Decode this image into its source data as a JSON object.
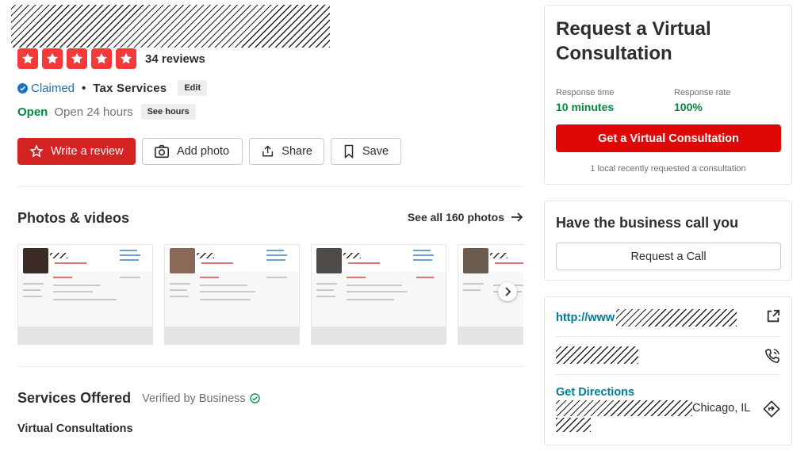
{
  "header": {
    "review_count": "34 reviews",
    "rating_stars": 5,
    "claimed_label": "Claimed",
    "separator": "•",
    "category": "Tax Services",
    "edit_label": "Edit",
    "status": "Open",
    "hours": "Open 24 hours",
    "see_hours_label": "See hours"
  },
  "actions": {
    "write_review": "Write a review",
    "add_photo": "Add photo",
    "share": "Share",
    "save": "Save"
  },
  "photos": {
    "title": "Photos & videos",
    "see_all": "See all 160 photos"
  },
  "services": {
    "title": "Services Offered",
    "verified": "Verified by Business",
    "items": [
      "Virtual Consultations"
    ]
  },
  "consultation": {
    "title": "Request a Virtual Consultation",
    "response_time_label": "Response time",
    "response_time_value": "10 minutes",
    "response_rate_label": "Response rate",
    "response_rate_value": "100%",
    "cta_label": "Get a Virtual Consultation",
    "note": "1 local recently requested a consultation"
  },
  "call": {
    "title": "Have the business call you",
    "button_label": "Request a Call"
  },
  "info": {
    "website_prefix": "http://www",
    "directions_label": "Get Directions",
    "city": "Chicago, IL"
  },
  "colors": {
    "brand_red": "#d32323",
    "star_red": "#f43939",
    "open_green": "#04873f",
    "link_teal": "#027a97",
    "claimed_blue": "#1a6fb5"
  }
}
